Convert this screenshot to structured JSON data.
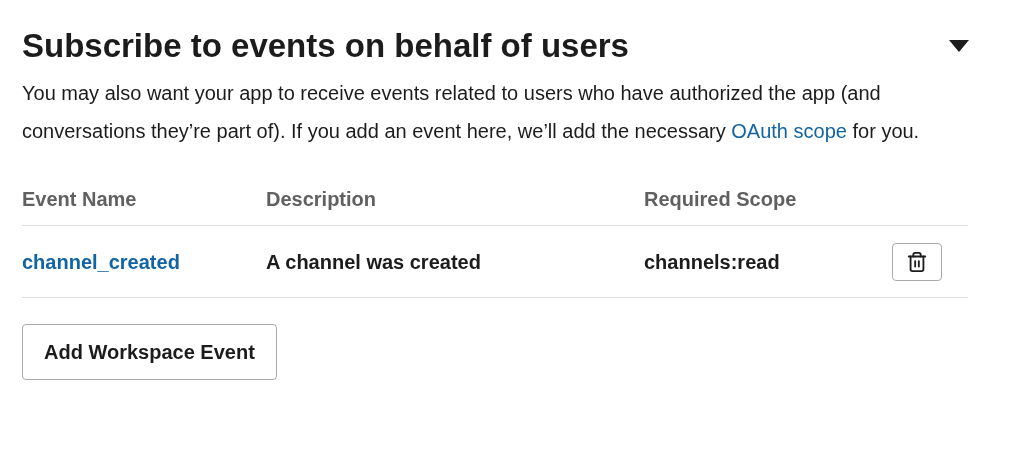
{
  "section": {
    "title": "Subscribe to events on behalf of users",
    "expanded": true,
    "description": {
      "before": "You may also want your app to receive events related to users who have authorized the app (and conversations they’re part of). If you add an event here, we’ll add the necessary ",
      "link": "OAuth scope",
      "after": " for you."
    }
  },
  "table": {
    "columns": [
      "Event Name",
      "Description",
      "Required Scope"
    ],
    "rows": [
      {
        "event": "channel_created",
        "description": "A channel was created",
        "scope": "channels:read"
      }
    ]
  },
  "buttons": [
    "Add Workspace Event"
  ]
}
